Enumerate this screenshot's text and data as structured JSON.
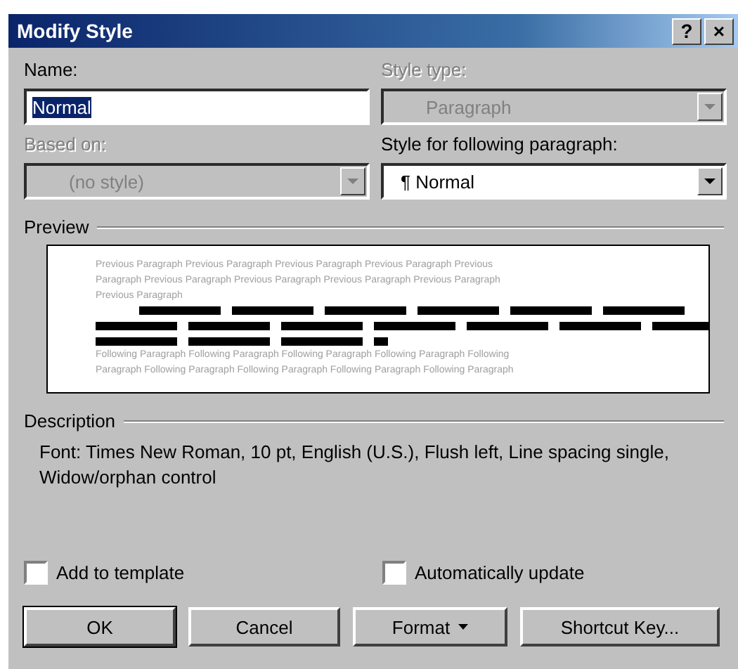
{
  "window": {
    "title": "Modify Style"
  },
  "title_buttons": [
    {
      "kind": "help",
      "label": "?"
    },
    {
      "kind": "close",
      "label": "×"
    }
  ],
  "fields": [
    {
      "kind": "text",
      "label": "Name:",
      "value": "Normal",
      "disabled": false,
      "selected": true
    },
    {
      "kind": "combo",
      "label": "Style type:",
      "value": "Paragraph",
      "disabled": true,
      "selected": false
    },
    {
      "kind": "combo",
      "label": "Based on:",
      "value": "(no style)",
      "disabled": true,
      "selected": false
    },
    {
      "kind": "combo",
      "label": "Style for following paragraph:",
      "value": "¶ Normal",
      "disabled": false,
      "selected": false
    }
  ],
  "preview": {
    "label": "Preview",
    "previous_lines": [
      "Previous Paragraph Previous Paragraph Previous Paragraph Previous Paragraph Previous",
      "Paragraph Previous Paragraph Previous Paragraph Previous Paragraph Previous Paragraph",
      "Previous Paragraph"
    ],
    "following_lines": [
      "Following Paragraph Following Paragraph Following Paragraph Following Paragraph Following",
      "Paragraph Following Paragraph Following Paragraph Following Paragraph Following Paragraph"
    ]
  },
  "description": {
    "label": "Description",
    "text": "Font: Times New Roman, 10 pt, English (U.S.), Flush left, Line spacing single, Widow/orphan control"
  },
  "checkboxes": [
    {
      "label": "Add to template",
      "checked": false
    },
    {
      "label": "Automatically update",
      "checked": false
    }
  ],
  "buttons": [
    {
      "label": "OK",
      "default": true,
      "has_menu": false
    },
    {
      "label": "Cancel",
      "default": false,
      "has_menu": false
    },
    {
      "label": "Format",
      "default": false,
      "has_menu": true
    },
    {
      "label": "Shortcut Key...",
      "default": false,
      "has_menu": false
    }
  ]
}
